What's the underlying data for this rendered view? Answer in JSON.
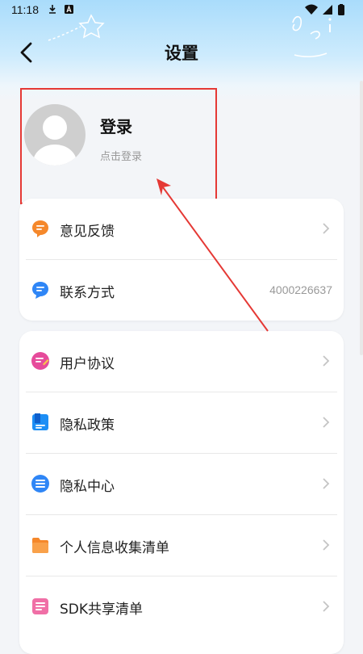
{
  "status_bar": {
    "time": "11:18"
  },
  "header": {
    "title": "设置"
  },
  "login": {
    "title": "登录",
    "subtitle": "点击登录"
  },
  "group1": [
    {
      "label": "意见反馈",
      "icon": "feedback-icon",
      "color": "#f5882b"
    },
    {
      "label": "联系方式",
      "icon": "contact-icon",
      "color": "#2f86f6",
      "value": "4000226637"
    }
  ],
  "group2": [
    {
      "label": "用户协议",
      "icon": "user-agreement-icon",
      "color": "#e64b9b"
    },
    {
      "label": "隐私政策",
      "icon": "privacy-policy-icon",
      "color": "#1c8ef5"
    },
    {
      "label": "隐私中心",
      "icon": "privacy-center-icon",
      "color": "#2f86f6"
    },
    {
      "label": "个人信息收集清单",
      "icon": "personal-info-icon",
      "color": "#f5882b"
    },
    {
      "label": "SDK共享清单",
      "icon": "sdk-list-icon",
      "color": "#f06fa6"
    }
  ],
  "colors": {
    "highlight": "#e53935",
    "accent": "#2f86f6",
    "header_gradient": "#a9dcfb"
  }
}
